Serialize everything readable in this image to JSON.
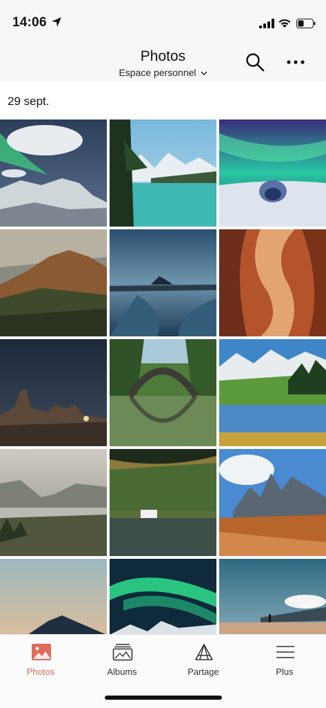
{
  "status_bar": {
    "time": "14:06"
  },
  "header": {
    "title": "Photos",
    "space_selector": "Espace personnel",
    "icons": [
      "search-icon",
      "more-icon"
    ]
  },
  "date_section": {
    "label": "29 sept."
  },
  "photos": [
    "aurora-mountain",
    "lake-mountains",
    "aurora-igloo",
    "cliff-valley",
    "island-castle",
    "slot-canyon",
    "night-rocks",
    "arch-bridge-reflection",
    "alpine-lake",
    "misty-valley-lake",
    "forest-lake-house",
    "dolomites-peaks",
    "sunset-volcano",
    "aurora-green",
    "beach-walker"
  ],
  "tabs": [
    {
      "label": "Photos",
      "icon": "photos-icon",
      "active": true
    },
    {
      "label": "Albums",
      "icon": "albums-icon",
      "active": false
    },
    {
      "label": "Partage",
      "icon": "share-icon",
      "active": false
    },
    {
      "label": "Plus",
      "icon": "menu-icon",
      "active": false
    }
  ],
  "colors": {
    "accent": "#e06b5b",
    "header_bg": "#f7f7f7"
  }
}
